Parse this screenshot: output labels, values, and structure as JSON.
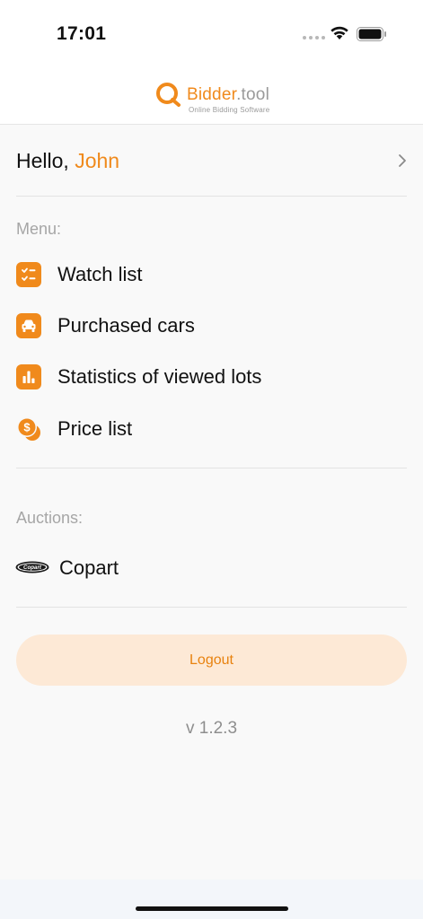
{
  "status_bar": {
    "time": "17:01",
    "icons": [
      "cellular-dots-icon",
      "wifi-icon",
      "battery-icon"
    ]
  },
  "header": {
    "logo_name_main": "Bidder",
    "logo_name_suffix": ".tool",
    "logo_tagline": "Online Bidding Software",
    "logo_icon": "logo-ring-icon"
  },
  "greeting": {
    "prefix": "Hello, ",
    "name": "John",
    "chevron_icon": "chevron-right-icon"
  },
  "menu": {
    "title": "Menu:",
    "items": [
      {
        "label": "Watch list",
        "icon": "checklist-icon"
      },
      {
        "label": "Purchased cars",
        "icon": "car-icon"
      },
      {
        "label": "Statistics of viewed lots",
        "icon": "bar-chart-icon"
      },
      {
        "label": "Price list",
        "icon": "dollar-coins-icon"
      }
    ]
  },
  "auctions": {
    "title": "Auctions:",
    "items": [
      {
        "label": "Copart",
        "icon": "copart-logo-icon",
        "logo_text": "Copart"
      }
    ]
  },
  "logout": {
    "label": "Logout"
  },
  "version": "v 1.2.3",
  "colors": {
    "accent": "#f08a1c",
    "logout_bg": "#fde9d6",
    "muted_text": "#a6a6a6",
    "background": "#f9f9f9"
  }
}
